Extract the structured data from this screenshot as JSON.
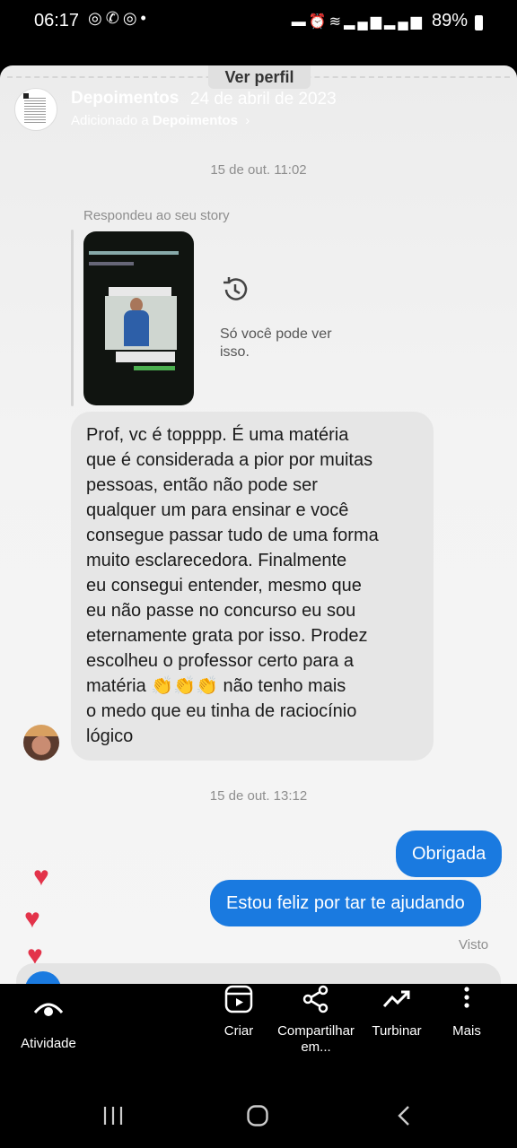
{
  "status_bar": {
    "time": "06:17",
    "battery": "89%",
    "left_icons": [
      "instagram-icon",
      "missed-call-icon",
      "instagram-icon",
      "dot-icon"
    ],
    "right_icons": [
      "bed-icon",
      "alarm-icon",
      "wifi-icon",
      "signal-icon",
      "signal-icon",
      "battery-icon"
    ]
  },
  "story": {
    "view_profile": "Ver perfil",
    "highlight_name": "Depoimentos",
    "highlight_date": "24 de abril de 2023",
    "added_prefix": "Adicionado a",
    "added_target": "Depoimentos"
  },
  "chat": {
    "timestamp_1": "15 de out. 11:02",
    "reply_label": "Respondeu ao seu story",
    "only_you": "Só você pode ver isso.",
    "incoming_message": "Prof, vc é topppp. É uma matéria\nque é considerada a pior por muitas\npessoas, então não pode ser\nqualquer um para ensinar e você\nconsegue passar tudo de uma forma\nmuito esclarecedora. Finalmente\neu consegui entender, mesmo que\neu não passe no concurso eu sou\neternamente grata por isso. Prodez\nescolheu o professor certo para a\nmatéria 👏👏👏 não tenho mais\no medo que eu tinha de raciocínio\nlógico",
    "timestamp_2": "15 de out. 13:12",
    "outgoing_1": "Obrigada",
    "outgoing_2": "Estou feliz por tar te ajudando",
    "seen": "Visto"
  },
  "toolbar": {
    "activity": "Atividade",
    "create": "Criar",
    "share": "Compartilhar em...",
    "boost": "Turbinar",
    "more": "Mais"
  },
  "colors": {
    "accent_blue": "#1a7ae0",
    "heart_red": "#e3334a",
    "bubble_gray": "#e6e6e6"
  }
}
